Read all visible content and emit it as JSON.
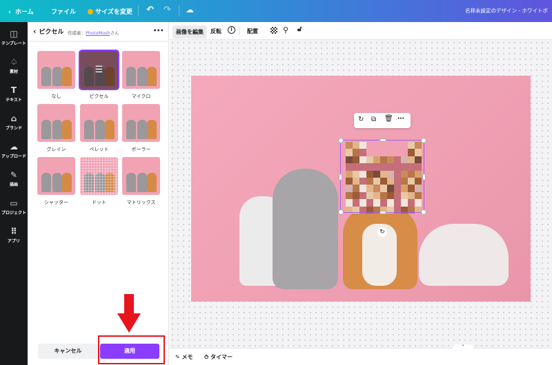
{
  "topbar": {
    "home": "ホーム",
    "file": "ファイル",
    "resize": "サイズを変更",
    "title": "名称未設定のデザイン - ホワイトボ"
  },
  "rail": [
    {
      "label": "テンプレート",
      "icon": "layout-icon"
    },
    {
      "label": "素材",
      "icon": "shapes-icon"
    },
    {
      "label": "テキスト",
      "icon": "text-icon"
    },
    {
      "label": "ブランド",
      "icon": "brand-icon"
    },
    {
      "label": "アップロード",
      "icon": "upload-icon"
    },
    {
      "label": "描画",
      "icon": "draw-icon"
    },
    {
      "label": "プロジェクト",
      "icon": "folder-icon"
    },
    {
      "label": "アプリ",
      "icon": "apps-icon"
    }
  ],
  "panel": {
    "title": "ピクセル",
    "author_prefix": "作成者：",
    "author": "PhotoMosh",
    "author_suffix": "さん",
    "more": "•••",
    "effects": [
      "なし",
      "ピクセル",
      "マイクロ",
      "グレイン",
      "ペレット",
      "ボーラー",
      "シャッター",
      "ドット",
      "マトリックス"
    ],
    "selected": "ピクセル",
    "cancel": "キャンセル",
    "apply": "適用"
  },
  "toolbar": {
    "edit_image": "画像を編集",
    "flip": "反転",
    "info": "i",
    "position": "配置"
  },
  "bottom": {
    "notes": "メモ",
    "timer": "タイマー"
  },
  "annotation_color": "#e8141c",
  "accent": "#8b3dff"
}
